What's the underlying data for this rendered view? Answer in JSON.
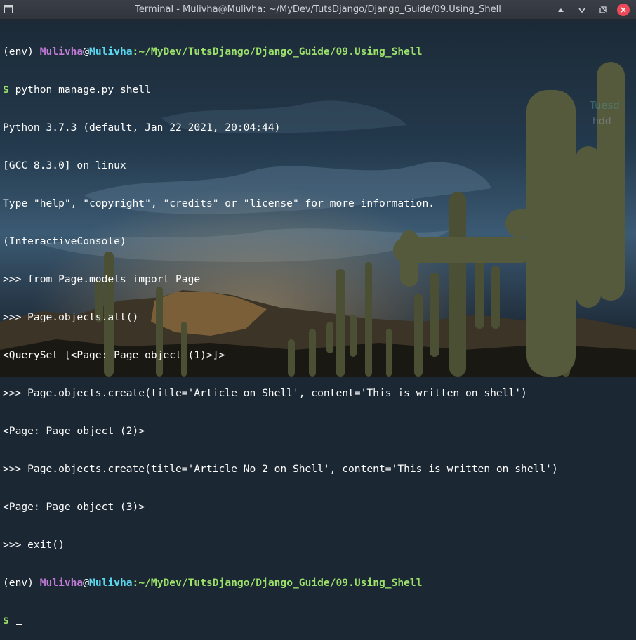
{
  "window": {
    "title": "Terminal - Mulivha@Mulivha: ~/MyDev/TutsDjango/Django_Guide/09.Using_Shell"
  },
  "desktop_widget": {
    "day": "Tuesd",
    "disk": "hdd"
  },
  "prompt": {
    "env": "(env) ",
    "user": "Mulivha",
    "at": "@",
    "host": "Mulivha",
    "colon": ":",
    "path": "~/MyDev/TutsDjango/Django_Guide/09.Using_Shell",
    "dollar": "$",
    "second_path": "~/MyDev/TutsDjango/Django_Guide/09.Using_Shell"
  },
  "output": {
    "cmd": " python manage.py shell",
    "l1": "Python 3.7.3 (default, Jan 22 2021, 20:04:44)",
    "l2": "[GCC 8.3.0] on linux",
    "l3": "Type \"help\", \"copyright\", \"credits\" or \"license\" for more information.",
    "l4": "(InteractiveConsole)",
    "l5": ">>> from Page.models import Page",
    "l6": ">>> Page.objects.all()",
    "l7": "<QuerySet [<Page: Page object (1)>]>",
    "l8": ">>> Page.objects.create(title='Article on Shell', content='This is written on shell')",
    "l9": "<Page: Page object (2)>",
    "l10": ">>> Page.objects.create(title='Article No 2 on Shell', content='This is written on shell')",
    "l11": "<Page: Page object (3)>",
    "l12": ">>> exit()"
  },
  "colors": {
    "user": "#c17ad6",
    "host": "#58d7ee",
    "path": "#9be16a",
    "text": "#fdfdfd",
    "close_button": "#ec4a59"
  },
  "icons": [
    "terminal-icon",
    "keep-above-icon",
    "minimize-icon",
    "maximize-icon",
    "close-icon"
  ]
}
